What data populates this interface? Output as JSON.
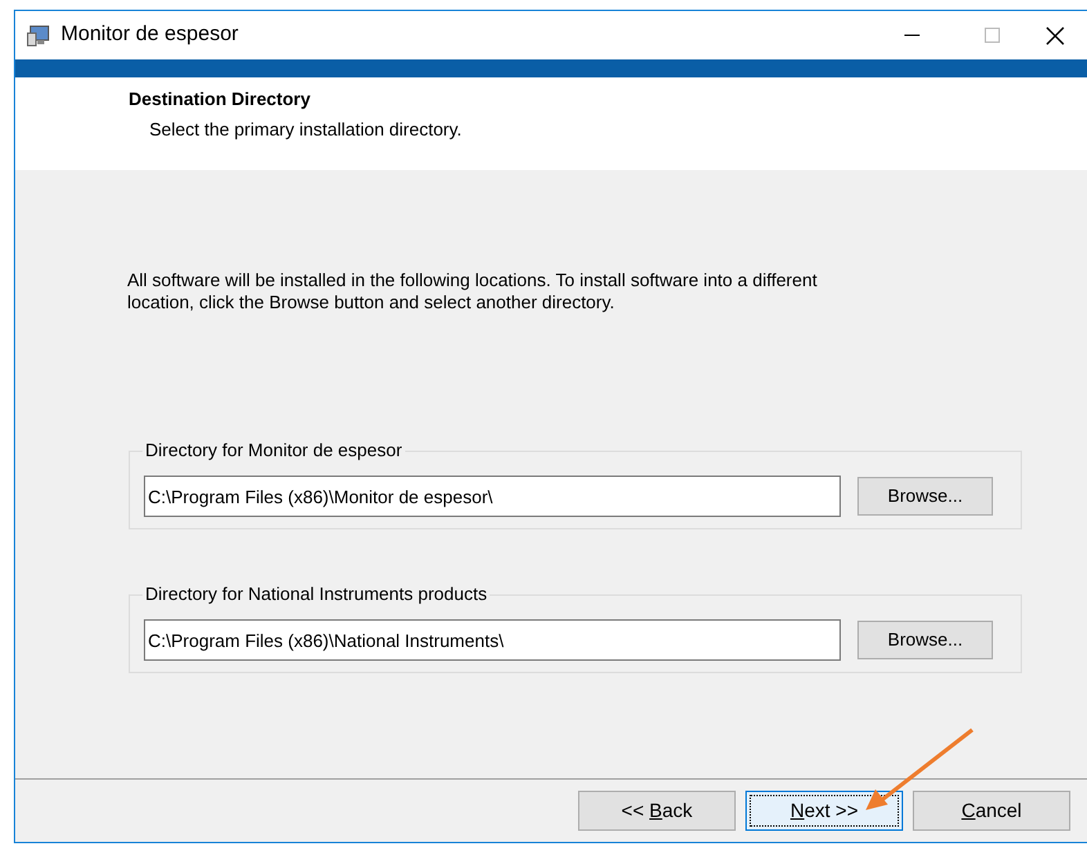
{
  "window": {
    "title": "Monitor de espesor"
  },
  "header": {
    "title": "Destination Directory",
    "subtitle": "Select the primary installation directory."
  },
  "description": "All software will be installed in the following locations. To install software into a different location, click the Browse button and select another directory.",
  "directories": [
    {
      "label": "Directory for Monitor de espesor",
      "value": "C:\\Program Files (x86)\\Monitor de espesor\\",
      "button": "Browse..."
    },
    {
      "label": "Directory for National Instruments products",
      "value": "C:\\Program Files (x86)\\National Instruments\\",
      "button": "Browse..."
    }
  ],
  "buttons": [
    {
      "before": "<< ",
      "accelerator": "B",
      "after": "ack",
      "selected": false
    },
    {
      "accelerator": "N",
      "after": "ext >>",
      "selected": true
    },
    {
      "accelerator": "C",
      "after": "ancel",
      "selected": false
    }
  ]
}
